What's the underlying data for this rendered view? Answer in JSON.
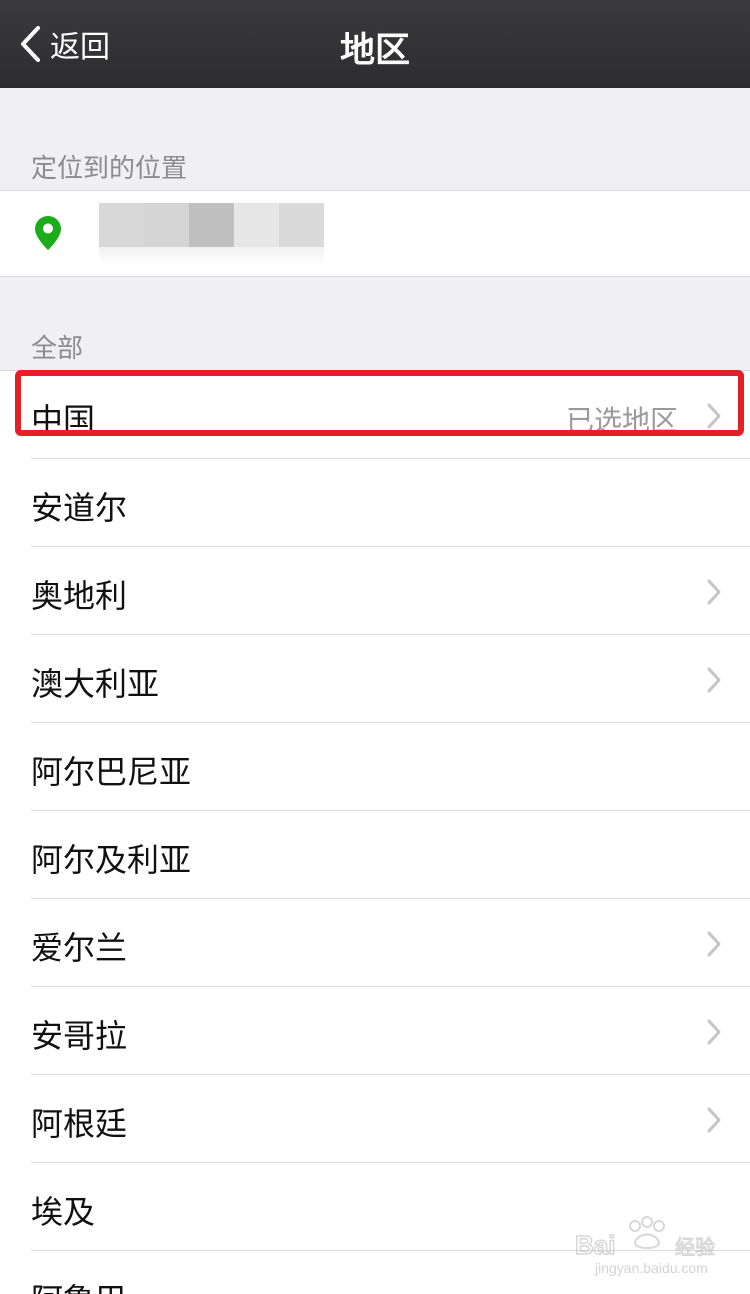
{
  "nav": {
    "back_label": "返回",
    "title": "地区"
  },
  "sections": {
    "located_header": "定位到的位置",
    "all_header": "全部"
  },
  "regions": [
    {
      "name": "中国",
      "status": "已选地区",
      "has_chevron": true
    },
    {
      "name": "安道尔",
      "status": "",
      "has_chevron": false
    },
    {
      "name": "奥地利",
      "status": "",
      "has_chevron": true
    },
    {
      "name": "澳大利亚",
      "status": "",
      "has_chevron": true
    },
    {
      "name": "阿尔巴尼亚",
      "status": "",
      "has_chevron": false
    },
    {
      "name": "阿尔及利亚",
      "status": "",
      "has_chevron": false
    },
    {
      "name": "爱尔兰",
      "status": "",
      "has_chevron": true
    },
    {
      "name": "安哥拉",
      "status": "",
      "has_chevron": true
    },
    {
      "name": "阿根廷",
      "status": "",
      "has_chevron": true
    },
    {
      "name": "埃及",
      "status": "",
      "has_chevron": false
    },
    {
      "name": "阿鲁巴",
      "status": "",
      "has_chevron": false
    }
  ],
  "colors": {
    "navbar": "#2f2f32",
    "pin": "#1aad19",
    "highlight": "#e61e25"
  },
  "icons": {
    "back": "chevron-left-icon",
    "location": "map-pin-icon",
    "disclosure": "chevron-right-icon"
  },
  "watermark": {
    "text": "jingyan.baidu.com"
  }
}
